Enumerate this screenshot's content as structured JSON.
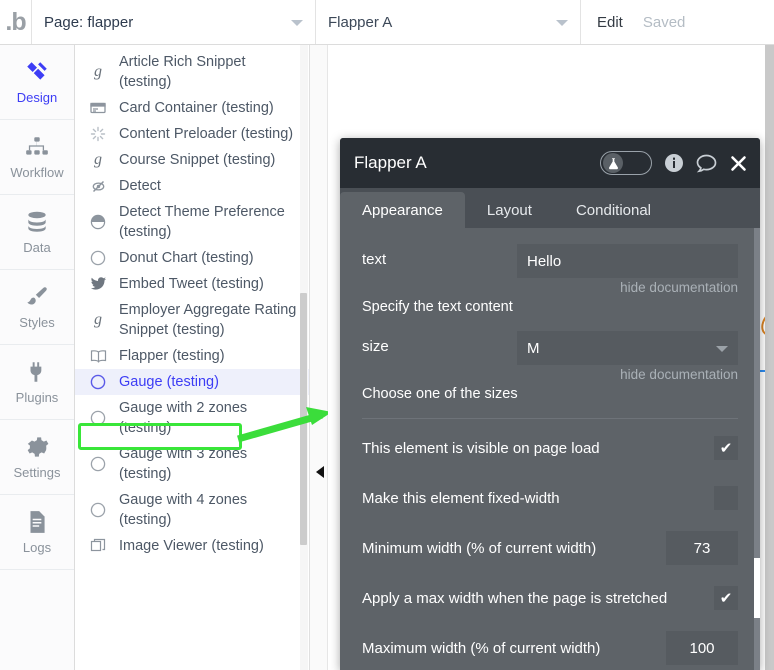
{
  "topbar": {
    "logo": "bubble-logo",
    "page_selector": "Page: flapper",
    "element_selector": "Flapper A",
    "edit_label": "Edit",
    "save_status": "Saved"
  },
  "rail": {
    "items": [
      {
        "label": "Design",
        "icon": "design-icon",
        "active": true
      },
      {
        "label": "Workflow",
        "icon": "workflow-icon",
        "active": false
      },
      {
        "label": "Data",
        "icon": "data-icon",
        "active": false
      },
      {
        "label": "Styles",
        "icon": "styles-icon",
        "active": false
      },
      {
        "label": "Plugins",
        "icon": "plugins-icon",
        "active": false
      },
      {
        "label": "Settings",
        "icon": "settings-icon",
        "active": false
      },
      {
        "label": "Logs",
        "icon": "logs-icon",
        "active": false
      }
    ]
  },
  "element_list": {
    "items": [
      {
        "label": "Article Rich Snippet (testing)",
        "icon": "g-snippet-icon"
      },
      {
        "label": "Card Container (testing)",
        "icon": "card-icon"
      },
      {
        "label": "Content Preloader (testing)",
        "icon": "spinner-icon"
      },
      {
        "label": "Course Snippet (testing)",
        "icon": "g-snippet-icon"
      },
      {
        "label": "Detect",
        "icon": "eye-slash-icon"
      },
      {
        "label": "Detect Theme Preference (testing)",
        "icon": "half-circle-icon"
      },
      {
        "label": "Donut Chart (testing)",
        "icon": "circle-outline-icon"
      },
      {
        "label": "Embed Tweet (testing)",
        "icon": "twitter-bird-icon"
      },
      {
        "label": "Employer Aggregate Rating Snippet (testing)",
        "icon": "g-snippet-icon"
      },
      {
        "label": "Flapper (testing)",
        "icon": "book-icon",
        "highlighted": true
      },
      {
        "label": "Gauge (testing)",
        "icon": "circle-outline-icon",
        "selected": true
      },
      {
        "label": "Gauge with 2 zones (testing)",
        "icon": "circle-outline-icon"
      },
      {
        "label": "Gauge with 3 zones (testing)",
        "icon": "circle-outline-icon"
      },
      {
        "label": "Gauge with 4 zones (testing)",
        "icon": "circle-outline-icon"
      },
      {
        "label": "Image Viewer (testing)",
        "icon": "window-icon"
      }
    ]
  },
  "annotation": {
    "highlight_color": "#39e639",
    "arrow": "green-arrow-pointing-right"
  },
  "modal": {
    "title": "Flapper A",
    "header_icons": [
      "beaker-toggle",
      "info-icon",
      "comment-icon",
      "close-icon"
    ],
    "tabs": [
      {
        "label": "Appearance",
        "active": true
      },
      {
        "label": "Layout",
        "active": false
      },
      {
        "label": "Conditional",
        "active": false
      }
    ],
    "fields": [
      {
        "label": "text",
        "type": "text",
        "value": "Hello",
        "doc_toggle": "hide documentation",
        "doc_text": "Specify the text content"
      },
      {
        "label": "size",
        "type": "select",
        "value": "M",
        "doc_toggle": "hide documentation",
        "doc_text": "Choose one of the sizes"
      }
    ],
    "options": [
      {
        "label": "This element is visible on page load",
        "type": "checkbox",
        "checked": true,
        "mark": "✔"
      },
      {
        "label": "Make this element fixed-width",
        "type": "checkbox",
        "checked": false,
        "mark": ""
      },
      {
        "label": "Minimum width (% of current width)",
        "type": "number",
        "value": "73"
      },
      {
        "label": "Apply a max width when the page is stretched",
        "type": "checkbox",
        "checked": true,
        "mark": "✔"
      },
      {
        "label": "Maximum width (% of current width)",
        "type": "number",
        "value": "100"
      }
    ]
  }
}
